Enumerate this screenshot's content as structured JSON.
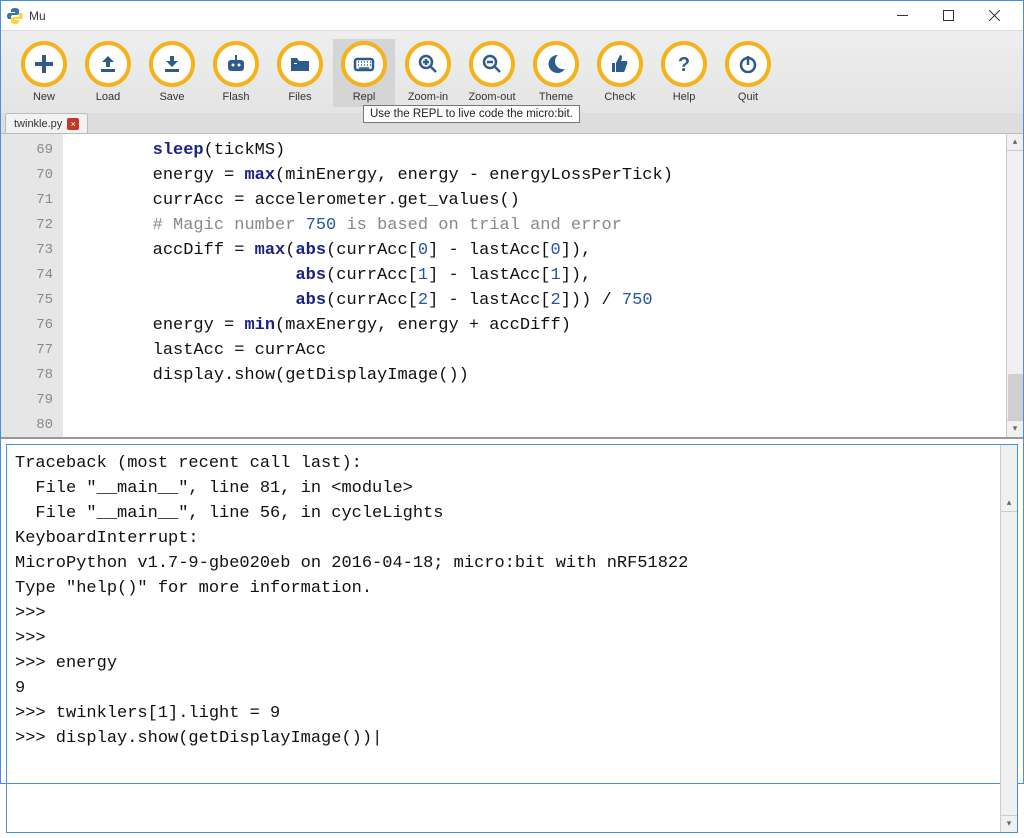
{
  "window": {
    "title": "Mu"
  },
  "toolbar": [
    {
      "id": "new",
      "label": "New",
      "icon": "plus"
    },
    {
      "id": "load",
      "label": "Load",
      "icon": "upload"
    },
    {
      "id": "save",
      "label": "Save",
      "icon": "download"
    },
    {
      "id": "flash",
      "label": "Flash",
      "icon": "robot"
    },
    {
      "id": "files",
      "label": "Files",
      "icon": "folder"
    },
    {
      "id": "repl",
      "label": "Repl",
      "icon": "keyboard",
      "active": true
    },
    {
      "id": "zoom-in",
      "label": "Zoom-in",
      "icon": "zoom-in"
    },
    {
      "id": "zoom-out",
      "label": "Zoom-out",
      "icon": "zoom-out"
    },
    {
      "id": "theme",
      "label": "Theme",
      "icon": "moon"
    },
    {
      "id": "check",
      "label": "Check",
      "icon": "thumb"
    },
    {
      "id": "help",
      "label": "Help",
      "icon": "question"
    },
    {
      "id": "quit",
      "label": "Quit",
      "icon": "power"
    }
  ],
  "tooltip": "Use the REPL to live code the micro:bit.",
  "tabs": [
    {
      "name": "twinkle.py"
    }
  ],
  "editor": {
    "first_line": 69,
    "lines": [
      "        sleep(tickMS)",
      "",
      "        energy = max(minEnergy, energy - energyLossPerTick)",
      "        currAcc = accelerometer.get_values()",
      "        # Magic number 750 is based on trial and error",
      "        accDiff = max(abs(currAcc[0] - lastAcc[0]),",
      "                      abs(currAcc[1] - lastAcc[1]),",
      "                      abs(currAcc[2] - lastAcc[2])) / 750",
      "        energy = min(maxEnergy, energy + accDiff)",
      "        lastAcc = currAcc",
      "",
      "        display.show(getDisplayImage())"
    ]
  },
  "repl": {
    "lines": [
      "Traceback (most recent call last):",
      "  File \"__main__\", line 81, in <module>",
      "  File \"__main__\", line 56, in cycleLights",
      "KeyboardInterrupt: ",
      "MicroPython v1.7-9-gbe020eb on 2016-04-18; micro:bit with nRF51822",
      "Type \"help()\" for more information.",
      ">>> ",
      ">>> ",
      ">>> energy",
      "9",
      ">>> twinklers[1].light = 9",
      ">>> display.show(getDisplayImage())"
    ]
  }
}
